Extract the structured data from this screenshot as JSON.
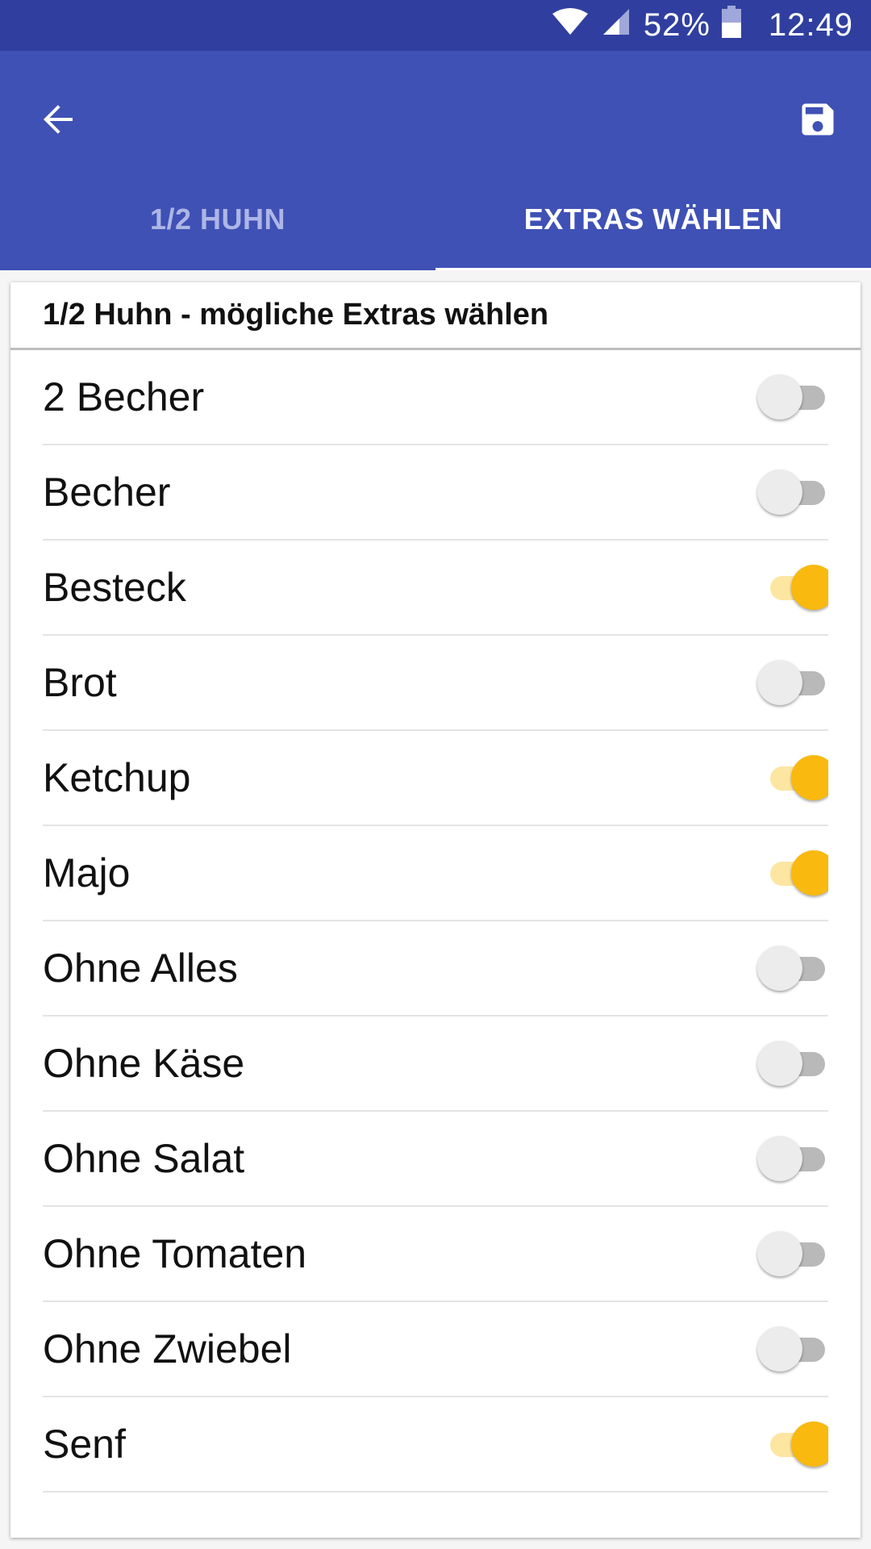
{
  "status_bar": {
    "battery_percent": "52%",
    "time": "12:49",
    "bar_color": "#303f9f"
  },
  "app_bar": {
    "color": "#3f51b5",
    "back_icon": "arrow-back-icon",
    "save_icon": "save-floppy-icon"
  },
  "tabs": [
    {
      "label": "1/2 HUHN",
      "active": false
    },
    {
      "label": "EXTRAS WÄHLEN",
      "active": true
    }
  ],
  "card": {
    "header": "1/2 Huhn - mögliche Extras wählen"
  },
  "extras": [
    {
      "label": "2 Becher",
      "checked": false
    },
    {
      "label": "Becher",
      "checked": false
    },
    {
      "label": "Besteck",
      "checked": true
    },
    {
      "label": "Brot",
      "checked": false
    },
    {
      "label": "Ketchup",
      "checked": true
    },
    {
      "label": "Majo",
      "checked": true
    },
    {
      "label": "Ohne Alles",
      "checked": false
    },
    {
      "label": "Ohne Käse",
      "checked": false
    },
    {
      "label": "Ohne Salat",
      "checked": false
    },
    {
      "label": "Ohne Tomaten",
      "checked": false
    },
    {
      "label": "Ohne Zwiebel",
      "checked": false
    },
    {
      "label": "Senf",
      "checked": true
    }
  ],
  "accent_color": "#f9b90e"
}
